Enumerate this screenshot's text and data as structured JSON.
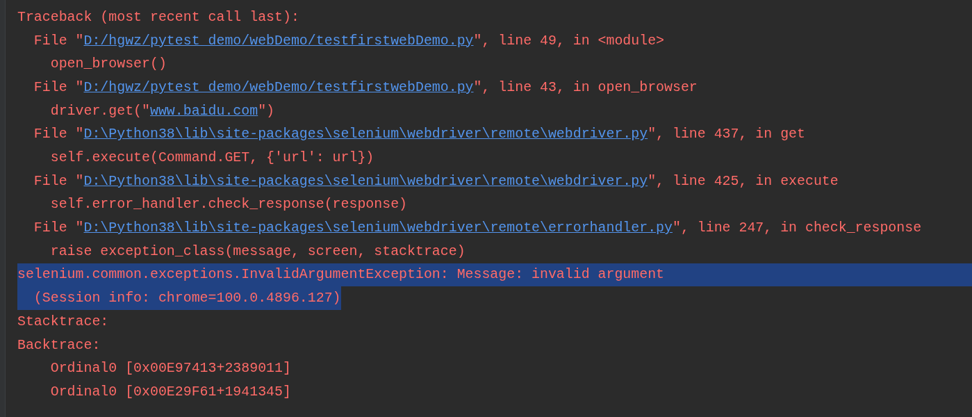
{
  "console": {
    "lines": [
      {
        "selected": false,
        "segments": [
          {
            "kind": "text",
            "text": "Traceback (most recent call last):"
          }
        ]
      },
      {
        "selected": false,
        "segments": [
          {
            "kind": "text",
            "text": "  File \""
          },
          {
            "kind": "link",
            "text": "D:/hgwz/pytest_demo/webDemo/testfirstwebDemo.py"
          },
          {
            "kind": "text",
            "text": "\", line 49, in <module>"
          }
        ]
      },
      {
        "selected": false,
        "segments": [
          {
            "kind": "text",
            "text": "    open_browser()"
          }
        ]
      },
      {
        "selected": false,
        "segments": [
          {
            "kind": "text",
            "text": "  File \""
          },
          {
            "kind": "link",
            "text": "D:/hgwz/pytest_demo/webDemo/testfirstwebDemo.py"
          },
          {
            "kind": "text",
            "text": "\", line 43, in open_browser"
          }
        ]
      },
      {
        "selected": false,
        "segments": [
          {
            "kind": "text",
            "text": "    driver.get(\""
          },
          {
            "kind": "link",
            "text": "www.baidu.com"
          },
          {
            "kind": "text",
            "text": "\")"
          }
        ]
      },
      {
        "selected": false,
        "segments": [
          {
            "kind": "text",
            "text": "  File \""
          },
          {
            "kind": "link",
            "text": "D:\\Python38\\lib\\site-packages\\selenium\\webdriver\\remote\\webdriver.py"
          },
          {
            "kind": "text",
            "text": "\", line 437, in get"
          }
        ]
      },
      {
        "selected": false,
        "segments": [
          {
            "kind": "text",
            "text": "    self.execute(Command.GET, {'url': url})"
          }
        ]
      },
      {
        "selected": false,
        "segments": [
          {
            "kind": "text",
            "text": "  File \""
          },
          {
            "kind": "link",
            "text": "D:\\Python38\\lib\\site-packages\\selenium\\webdriver\\remote\\webdriver.py"
          },
          {
            "kind": "text",
            "text": "\", line 425, in execute"
          }
        ]
      },
      {
        "selected": false,
        "segments": [
          {
            "kind": "text",
            "text": "    self.error_handler.check_response(response)"
          }
        ]
      },
      {
        "selected": false,
        "segments": [
          {
            "kind": "text",
            "text": "  File \""
          },
          {
            "kind": "link",
            "text": "D:\\Python38\\lib\\site-packages\\selenium\\webdriver\\remote\\errorhandler.py"
          },
          {
            "kind": "text",
            "text": "\", line 247, in check_response"
          }
        ]
      },
      {
        "selected": false,
        "segments": [
          {
            "kind": "text",
            "text": "    raise exception_class(message, screen, stacktrace)"
          }
        ]
      },
      {
        "selected": true,
        "full": true,
        "segments": [
          {
            "kind": "text",
            "text": "selenium.common.exceptions.InvalidArgumentException: Message: invalid argument"
          }
        ]
      },
      {
        "selected": true,
        "full": false,
        "segments": [
          {
            "kind": "text",
            "text": "  (Session info: chrome=100.0.4896.127)"
          }
        ]
      },
      {
        "selected": false,
        "segments": [
          {
            "kind": "text",
            "text": "Stacktrace:"
          }
        ]
      },
      {
        "selected": false,
        "segments": [
          {
            "kind": "text",
            "text": "Backtrace:"
          }
        ]
      },
      {
        "selected": false,
        "segments": [
          {
            "kind": "text",
            "text": "    Ordinal0 [0x00E97413+2389011]"
          }
        ]
      },
      {
        "selected": false,
        "segments": [
          {
            "kind": "text",
            "text": "    Ordinal0 [0x00E29F61+1941345]"
          }
        ]
      }
    ]
  }
}
